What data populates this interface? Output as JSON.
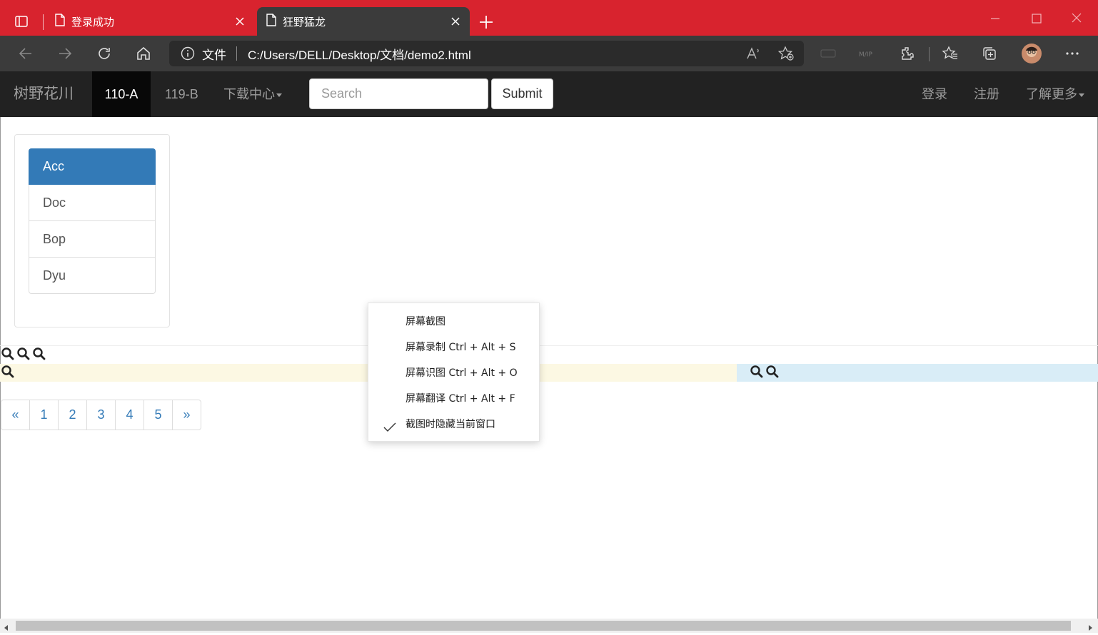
{
  "browser": {
    "tabs": [
      {
        "title": "登录成功",
        "active": false
      },
      {
        "title": "狂野猛龙",
        "active": true
      }
    ],
    "new_tab": "+",
    "address": {
      "security_label": "文件",
      "url": "C:/Users/DELL/Desktop/文档/demo2.html"
    },
    "window_controls": {
      "minimize": "—",
      "maximize": "☐",
      "close": "✕"
    },
    "colors": {
      "titlebar": "#d8232e",
      "toolbar": "#3b3b3b"
    }
  },
  "navbar": {
    "brand": "树野花川",
    "items": [
      {
        "label": "110-A",
        "active": true
      },
      {
        "label": "119-B",
        "active": false
      },
      {
        "label": "下载中心",
        "dropdown": true
      }
    ],
    "search": {
      "placeholder": "Search",
      "value": ""
    },
    "submit_label": "Submit",
    "right_items": [
      {
        "label": "登录"
      },
      {
        "label": "注册"
      },
      {
        "label": "了解更多",
        "dropdown": true
      }
    ]
  },
  "list_group": {
    "items": [
      {
        "label": "Acc",
        "active": true
      },
      {
        "label": "Doc",
        "active": false
      },
      {
        "label": "Bop",
        "active": false
      },
      {
        "label": "Dyu",
        "active": false
      }
    ]
  },
  "pagination": {
    "prev": "«",
    "pages": [
      "1",
      "2",
      "3",
      "4",
      "5"
    ],
    "next": "»"
  },
  "context_menu": {
    "items": [
      {
        "label": "屏幕截图",
        "checked": false
      },
      {
        "label": "屏幕录制 Ctrl + Alt + S",
        "checked": false
      },
      {
        "label": "屏幕识图 Ctrl + Alt + O",
        "checked": false
      },
      {
        "label": "屏幕翻译 Ctrl + Alt + F",
        "checked": false
      },
      {
        "label": "截图时隐藏当前窗口",
        "checked": true
      }
    ]
  }
}
